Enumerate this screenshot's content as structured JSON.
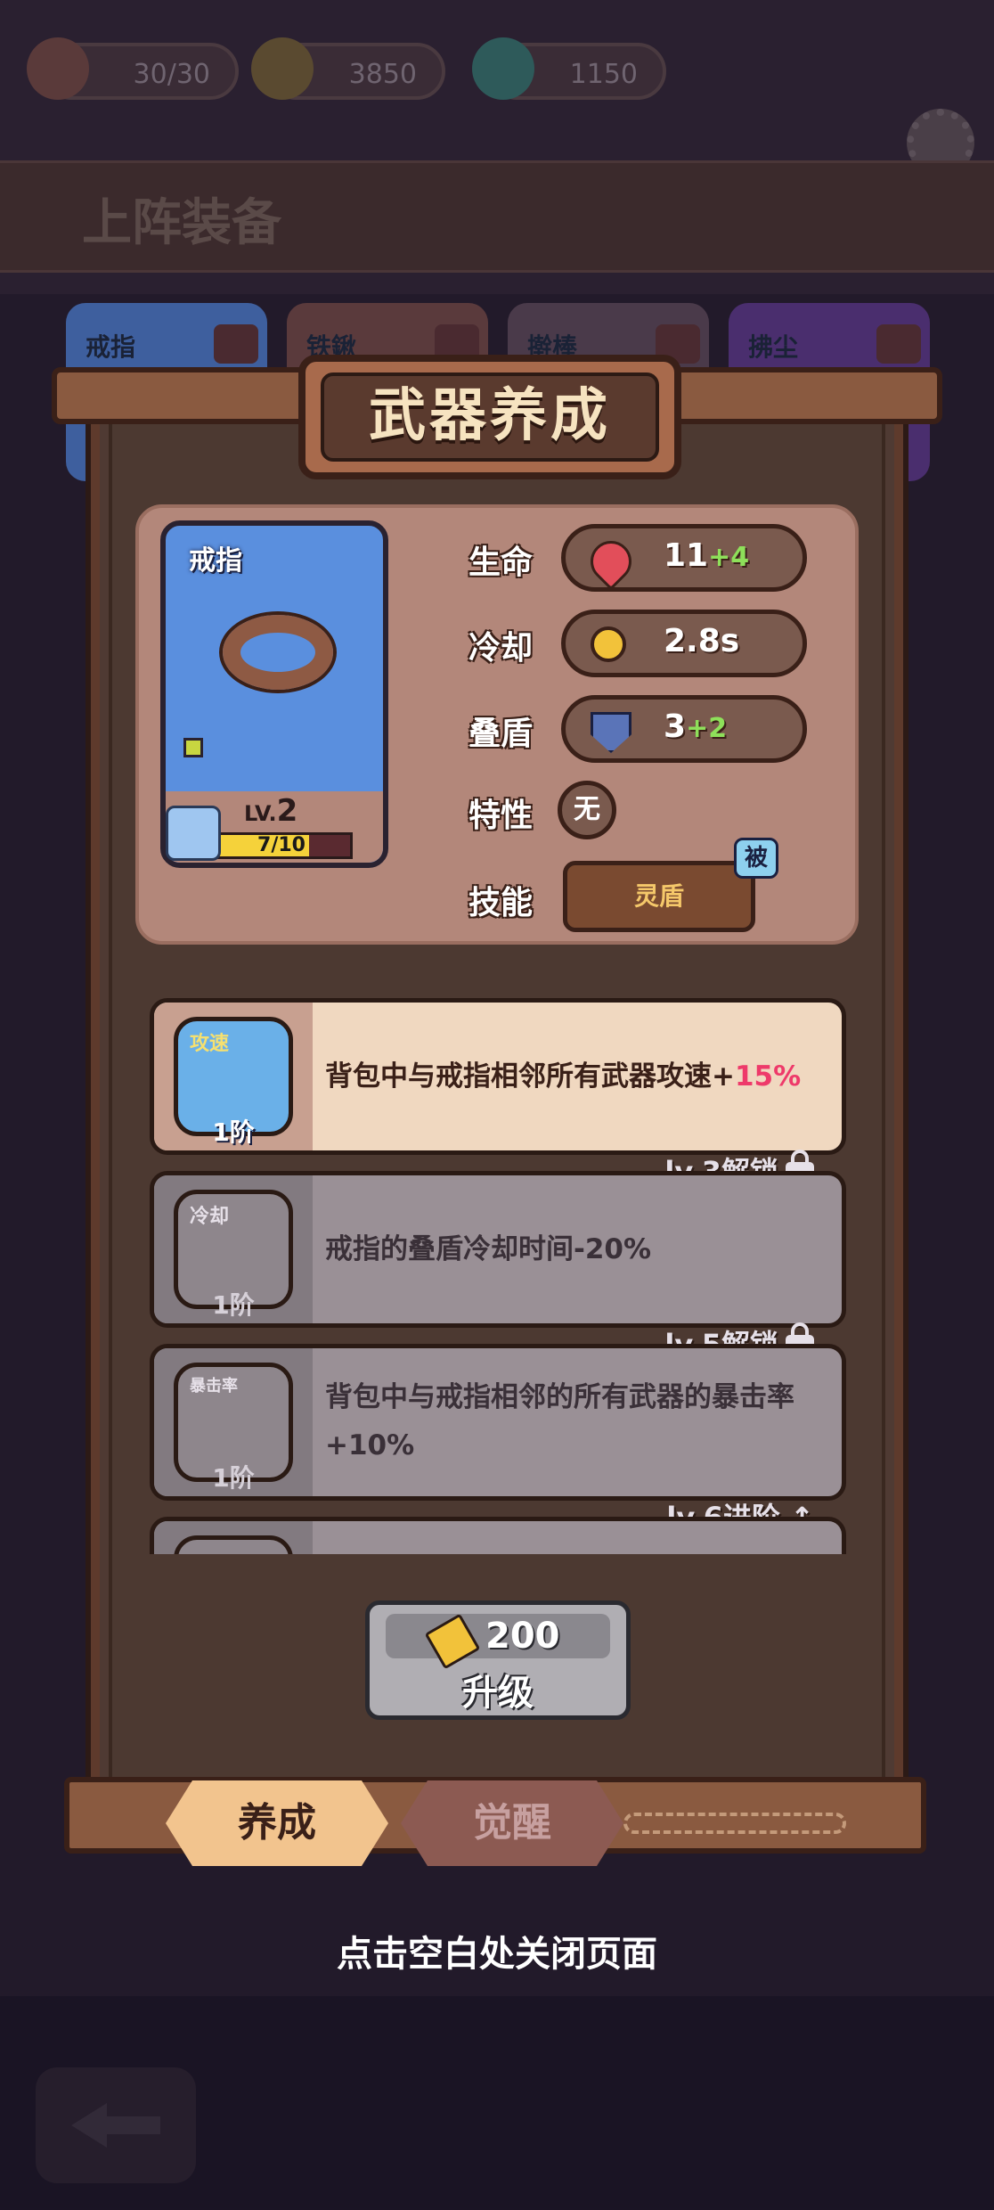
{
  "resources": [
    {
      "icon": "peach-icon",
      "value": "30/30"
    },
    {
      "icon": "sword-coin-icon",
      "value": "3850"
    },
    {
      "icon": "jade-ring-icon",
      "value": "1150"
    }
  ],
  "background": {
    "section_title": "上阵装备",
    "slots": [
      {
        "label": "戒指",
        "color": "#3e5f9e"
      },
      {
        "label": "铁鍬",
        "color": "#5a3a3c"
      },
      {
        "label": "擀棒",
        "color": "#4a3a4a"
      },
      {
        "label": "拂尘",
        "color": "#4a2e6e"
      }
    ]
  },
  "panel": {
    "title": "武器养成",
    "weapon": {
      "name": "戒指",
      "level_label": "LV.",
      "level": "2",
      "exp_text": "7/10",
      "exp_fraction": 0.7,
      "card_color": "#5a8fde"
    },
    "stats": [
      {
        "label": "生命",
        "icon": "heart-icon",
        "value": "11",
        "bonus": "+4"
      },
      {
        "label": "冷却",
        "icon": "stopwatch-icon",
        "value": "2.8s",
        "bonus": ""
      },
      {
        "label": "叠盾",
        "icon": "shield-plus-icon",
        "value": "3",
        "bonus": "+2"
      }
    ],
    "trait": {
      "label": "特性",
      "value": "无"
    },
    "skill": {
      "label": "技能",
      "value": "灵盾",
      "tag": "被"
    },
    "talents": [
      {
        "icon_label": "攻速",
        "tier": "1阶",
        "desc_pre": "背包中与戒指相邻所有武器攻速+",
        "desc_hl": "15%",
        "unlocked": true,
        "lock_text": ""
      },
      {
        "icon_label": "冷却",
        "tier": "1阶",
        "desc_pre": "戒指的叠盾冷却时间-20%",
        "desc_hl": "",
        "unlocked": false,
        "lock_text": "lv.3解锁"
      },
      {
        "icon_label": "暴击率",
        "tier": "1阶",
        "desc_pre": "背包中与戒指相邻的所有武器的暴击率+10%",
        "desc_hl": "",
        "unlocked": false,
        "lock_text": "lv.5解锁"
      },
      {
        "icon_label": "",
        "tier": "",
        "desc_pre": "",
        "desc_hl": "",
        "unlocked": false,
        "lock_text": "lv.6进阶"
      }
    ],
    "upgrade": {
      "cost": "200",
      "label": "升级"
    },
    "tabs": [
      {
        "label": "养成",
        "active": true
      },
      {
        "label": "觉醒",
        "active": false
      }
    ]
  },
  "close_hint": "点击空白处关闭页面",
  "colors": {
    "panel_wood": "#4f3a33",
    "info_card": "#b3877a",
    "talent_unlocked_bg": "#f0d8c0",
    "talent_locked_bg": "#9a9096",
    "highlight": "#ee3a6a",
    "bonus_green": "#8ee05a"
  }
}
